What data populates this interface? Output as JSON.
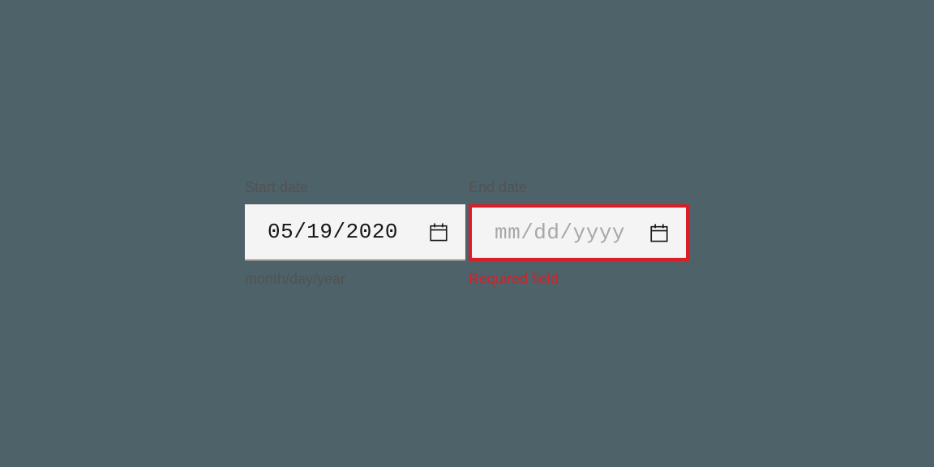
{
  "startDate": {
    "label": "Start date",
    "value": "05/19/2020",
    "helper": "month/day/year"
  },
  "endDate": {
    "label": "End date",
    "placeholder": "mm/dd/yyyy",
    "error": "Required field"
  }
}
